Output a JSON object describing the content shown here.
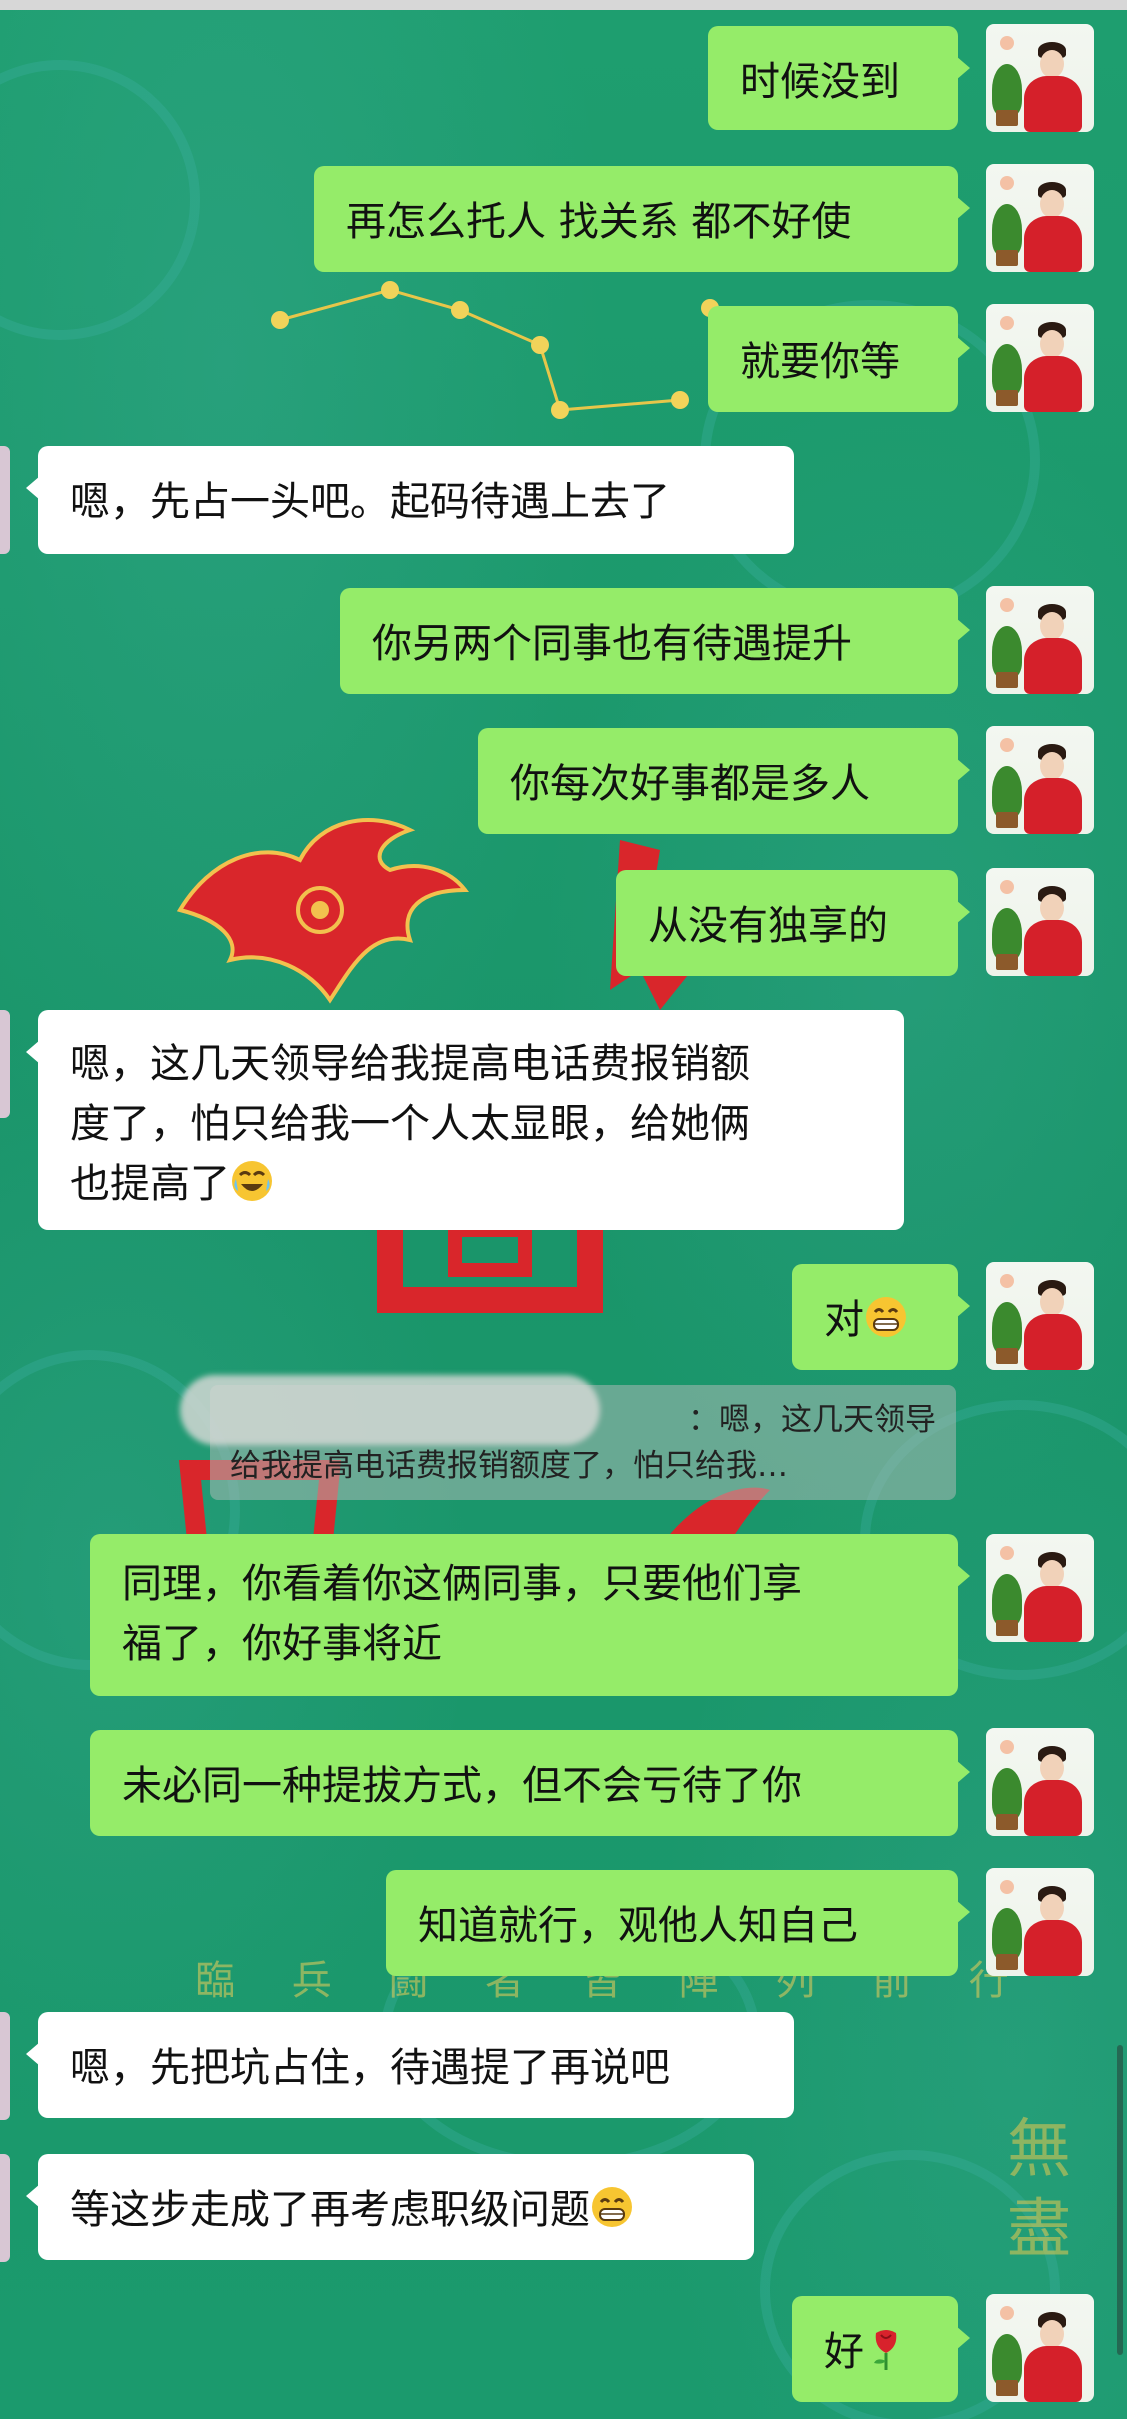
{
  "chat": {
    "messages": [
      {
        "side": "right",
        "text": "时候没到"
      },
      {
        "side": "right",
        "text": "再怎么托人 找关系 都不好使"
      },
      {
        "side": "right",
        "text": "就要你等"
      },
      {
        "side": "left",
        "text": "嗯，先占一头吧。起码待遇上去了"
      },
      {
        "side": "right",
        "text": "你另两个同事也有待遇提升"
      },
      {
        "side": "right",
        "text": "你每次好事都是多人"
      },
      {
        "side": "right",
        "text": "从没有独享的"
      },
      {
        "side": "left",
        "line1": "嗯，这几天领导给我提高电话费报销额",
        "line2": "度了，怕只给我一个人太显眼，给她俩",
        "line3": "也提高了",
        "emoji": "laughing-crying-emoji"
      },
      {
        "side": "right",
        "text": "对",
        "emoji": "grinning-emoji"
      },
      {
        "side": "right",
        "line1": "同理，你看着你这俩同事，只要他们享",
        "line2": "福了，你好事将近"
      },
      {
        "side": "right",
        "text": "未必同一种提拔方式，但不会亏待了你"
      },
      {
        "side": "right",
        "text": "知道就行，观他人知自己"
      },
      {
        "side": "left",
        "text": "嗯，先把坑占住，待遇提了再说吧"
      },
      {
        "side": "left",
        "text": "等这步走成了再考虑职级问题",
        "emoji": "grinning-emoji"
      },
      {
        "side": "right",
        "text": "好",
        "emoji": "rose-emoji"
      }
    ],
    "quote": {
      "line1": "：嗯，这几天领导",
      "line2": "给我提高电话费报销额度了，怕只给我…"
    }
  },
  "background": {
    "deco_text": "臨 兵 闘 者 皆 陣 列 前 行",
    "wuji": "無盡"
  },
  "colors": {
    "right_bubble": "#95ec69",
    "left_bubble": "#ffffff",
    "background": "#1c9a6c"
  }
}
